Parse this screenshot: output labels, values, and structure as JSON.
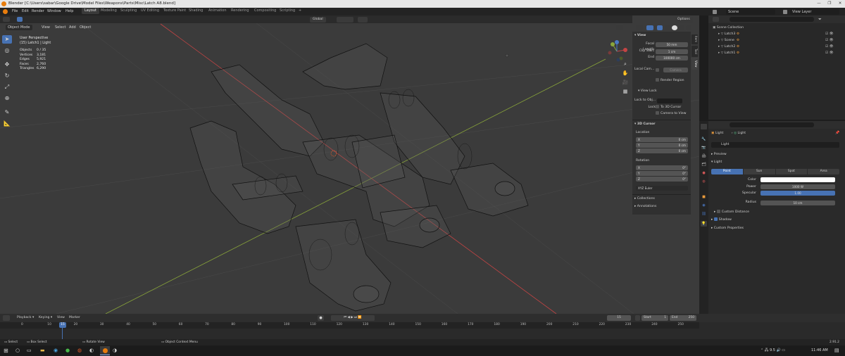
{
  "window": {
    "title": "Blender [C:\\Users\\sabar\\Google Drive\\Model Files\\Weapons\\Parts\\Misc\\Latch A8.blend]",
    "controls": [
      "—",
      "❐",
      "✕"
    ]
  },
  "menubar": {
    "items": [
      "File",
      "Edit",
      "Render",
      "Window",
      "Help"
    ],
    "workspaces": [
      "Layout",
      "Modeling",
      "Sculpting",
      "UV Editing",
      "Texture Paint",
      "Shading",
      "Animation",
      "Rendering",
      "Compositing",
      "Scripting",
      "+"
    ],
    "active_workspace": "Layout",
    "scene_label": "Scene",
    "view_layer_label": "View Layer"
  },
  "viewport_header": {
    "mode": "Object Mode",
    "menus": [
      "View",
      "Select",
      "Add",
      "Object"
    ],
    "transform_orientation": "Global",
    "options_label": "Options"
  },
  "viewport_overlay": {
    "view_name": "User Perspective",
    "collection_info": "(15) Latch1 | Light",
    "stats": [
      {
        "label": "Objects",
        "value": "0 / 35"
      },
      {
        "label": "Vertices",
        "value": "3,181"
      },
      {
        "label": "Edges",
        "value": "5,921"
      },
      {
        "label": "Faces",
        "value": "2,760"
      },
      {
        "label": "Triangles",
        "value": "6,290"
      }
    ],
    "gizmo_axes": [
      "X",
      "Y",
      "Z"
    ]
  },
  "npanel": {
    "tabs": [
      "Item",
      "Tool",
      "View"
    ],
    "active_tab": "View",
    "view_section": "View",
    "focal_length_label": "Focal Length",
    "focal_length": "50 mm",
    "clip_start_label": "Clip Start",
    "clip_start": "1 cm",
    "clip_end_label": "End",
    "clip_end": "100000 cm",
    "local_camera_label": "Local Cam...",
    "local_camera_value": "Camera",
    "render_region_label": "Render Region",
    "view_lock_section": "View Lock",
    "lock_to_object_label": "Lock to Obj...",
    "lock_label": "Lock",
    "to_3d_cursor_label": "To 3D Cursor",
    "camera_to_view_label": "Camera to View",
    "cursor_section": "3D Cursor",
    "location_label": "Location",
    "location": [
      {
        "axis": "X",
        "value": "0 cm"
      },
      {
        "axis": "Y",
        "value": "0 cm"
      },
      {
        "axis": "Z",
        "value": "0 cm"
      }
    ],
    "rotation_label": "Rotation",
    "rotation": [
      {
        "axis": "X",
        "value": "0°"
      },
      {
        "axis": "Y",
        "value": "0°"
      },
      {
        "axis": "Z",
        "value": "0°"
      }
    ],
    "rotation_mode": "XYZ Euler",
    "collections_section": "Collections",
    "annotations_section": "Annotations"
  },
  "outliner": {
    "root": "Scene Collection",
    "items": [
      {
        "name": "Latch3",
        "selected": false
      },
      {
        "name": "Scene",
        "selected": false
      },
      {
        "name": "Latch2",
        "selected": false
      },
      {
        "name": "Latch1",
        "selected": false
      }
    ]
  },
  "properties": {
    "breadcrumb_object": "Light",
    "breadcrumb_data": "Light",
    "datablock_name": "Light",
    "preview_section": "Preview",
    "light_section": "Light",
    "light_types": [
      "Point",
      "Sun",
      "Spot",
      "Area"
    ],
    "active_light_type": "Point",
    "color_label": "Color",
    "color": "#ffffff",
    "power_label": "Power",
    "power": "1000 W",
    "specular_label": "Specular",
    "specular": "1.00",
    "radius_label": "Radius",
    "radius": "10 cm",
    "custom_distance_label": "Custom Distance",
    "shadow_label": "Shadow",
    "custom_properties_label": "Custom Properties"
  },
  "timeline": {
    "menus": [
      "Playback",
      "Keying",
      "View",
      "Marker"
    ],
    "current_frame": "15",
    "start_label": "Start",
    "start": "1",
    "end_label": "End",
    "end": "250",
    "ticks": [
      "0",
      "10",
      "20",
      "30",
      "40",
      "50",
      "60",
      "70",
      "80",
      "90",
      "100",
      "110",
      "120",
      "130",
      "140",
      "150",
      "160",
      "170",
      "180",
      "190",
      "200",
      "210",
      "220",
      "230",
      "240",
      "250"
    ]
  },
  "statusbar": {
    "select": "Select",
    "box_select": "Box Select",
    "rotate_view": "Rotate View",
    "context_menu": "Object Context Menu",
    "version": "2.91.2"
  },
  "taskbar": {
    "clock": "11:46 AM",
    "tray": "9.5"
  },
  "colors": {
    "accent": "#4772b3",
    "x_axis": "#c44444",
    "y_axis": "#8aa63a",
    "viewport_bg": "#3b3b3b"
  }
}
